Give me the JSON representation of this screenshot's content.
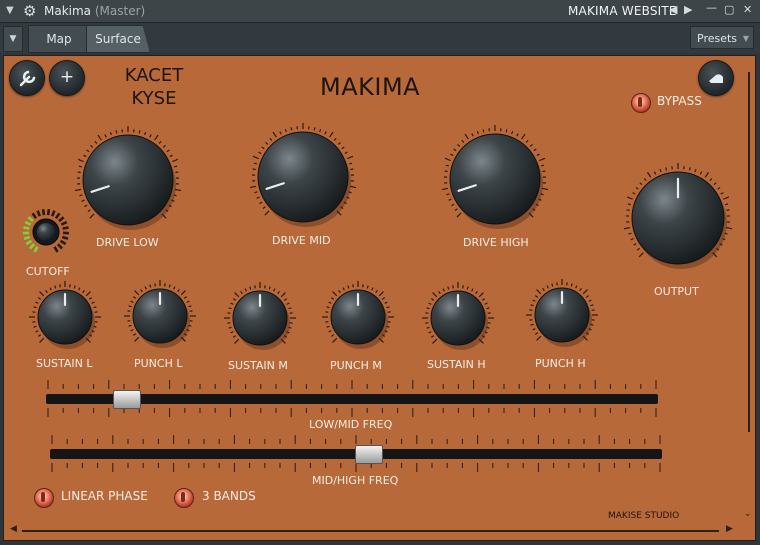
{
  "window": {
    "title": "Makima",
    "title_sub": "(Master)",
    "website_label": "MAKIMA WEBSITE"
  },
  "toolbar": {
    "tabs": [
      "Map",
      "Surface"
    ],
    "presets_label": "Presets"
  },
  "plugin": {
    "title": "MAKIMA",
    "brand_line1": "KACET",
    "brand_line2": "KYSE",
    "studio": "MAKISE STUDIO",
    "bypass_label": "BYPASS",
    "linear_phase_label": "LINEAR PHASE",
    "bands_label": "3 BANDS",
    "big_knobs": [
      {
        "label": "DRIVE LOW",
        "value": 0.1
      },
      {
        "label": "DRIVE MID",
        "value": 0.1
      },
      {
        "label": "DRIVE HIGH",
        "value": 0.1
      },
      {
        "label": "OUTPUT",
        "value": 0.5
      }
    ],
    "small_knobs": [
      {
        "label": "SUSTAIN L",
        "value": 0.5
      },
      {
        "label": "PUNCH L",
        "value": 0.5
      },
      {
        "label": "SUSTAIN M",
        "value": 0.5
      },
      {
        "label": "PUNCH M",
        "value": 0.5
      },
      {
        "label": "SUSTAIN H",
        "value": 0.5
      },
      {
        "label": "PUNCH H",
        "value": 0.5
      }
    ],
    "cutoff": {
      "label": "CUTOFF",
      "value": 0.35
    },
    "sliders": [
      {
        "label": "LOW/MID FREQ",
        "value": 0.13
      },
      {
        "label": "MID/HIGH FREQ",
        "value": 0.52
      }
    ]
  },
  "colors": {
    "surface": "#b8693a",
    "knob": "#2a3034",
    "led": "#f08368",
    "cutoff_ring": "#7fd33a"
  },
  "icons": {
    "settings": "wrench-icon",
    "add": "plus-icon",
    "menu": "hand-menu-icon"
  }
}
